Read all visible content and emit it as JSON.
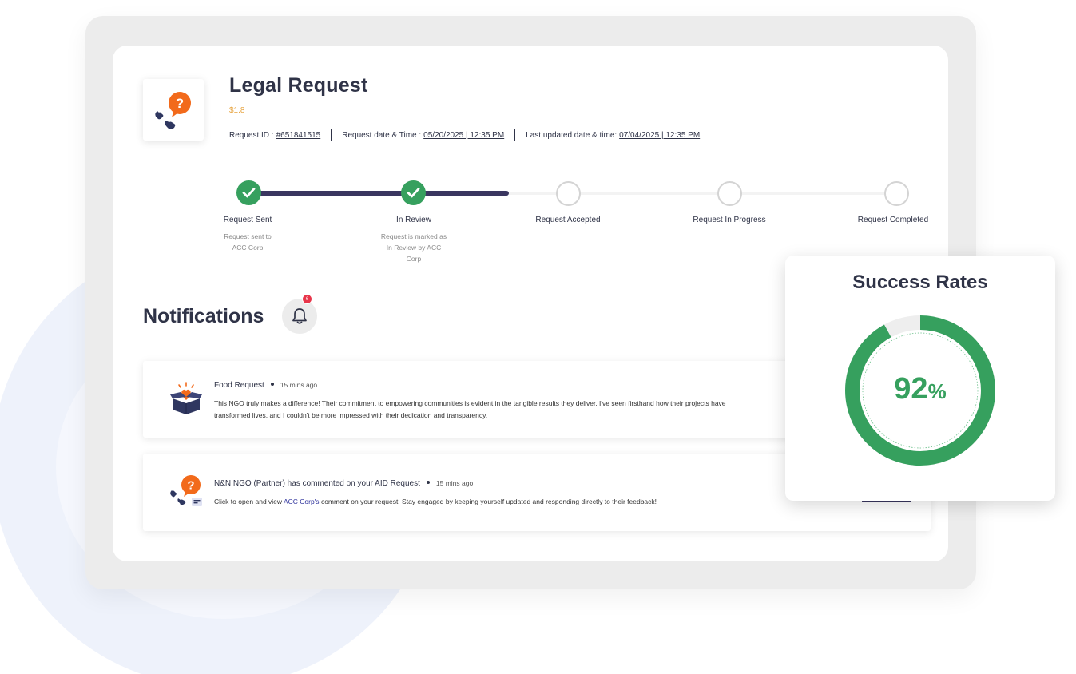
{
  "request": {
    "title": "Legal Request",
    "price": "$1.8",
    "id_label": "Request ID :",
    "id_value": "#651841515",
    "date_label": "Request date & Time :",
    "date_value": "05/20/2025 | 12:35 PM",
    "updated_label": "Last updated date & time:",
    "updated_value": "07/04/2025 | 12:35 PM",
    "icon": "legal-help-icon"
  },
  "progress": {
    "completed_fraction": 0.4,
    "steps": [
      {
        "label": "Request Sent",
        "desc": "Request sent to ACC Corp",
        "done": true
      },
      {
        "label": "In Review",
        "desc": "Request is marked as In Review by ACC Corp",
        "done": true
      },
      {
        "label": "Request Accepted",
        "desc": "",
        "done": false
      },
      {
        "label": "Request In Progress",
        "desc": "",
        "done": false
      },
      {
        "label": "Request Completed",
        "desc": "",
        "done": false
      }
    ]
  },
  "notifications": {
    "title": "Notifications",
    "badge_count": "6",
    "items": [
      {
        "icon": "food-box-heart-icon",
        "title": "Food Request",
        "time": "15 mins ago",
        "body": "This NGO truly makes a difference! Their commitment to empowering communities is evident in the tangible results they deliver. I've seen firsthand how their projects have transformed lives, and I couldn't be more impressed with their dedication and transparency."
      },
      {
        "icon": "legal-comment-icon",
        "title": "N&N NGO (Partner) has commented on your AID Request",
        "time": "15 mins ago",
        "body_before": "Click to open and view",
        "body_link": "ACC Corp's",
        "body_after": "comment on your request. Stay engaged by keeping yourself updated and responding directly to their feedback!"
      }
    ]
  },
  "success": {
    "title": "Success Rates",
    "value": "92",
    "unit": "%",
    "rate": 0.92
  },
  "colors": {
    "accent_green": "#36a05e",
    "navy": "#3a3660",
    "orange": "#f26a1b",
    "price_gold": "#e6a23c",
    "badge_red": "#e8354a"
  }
}
